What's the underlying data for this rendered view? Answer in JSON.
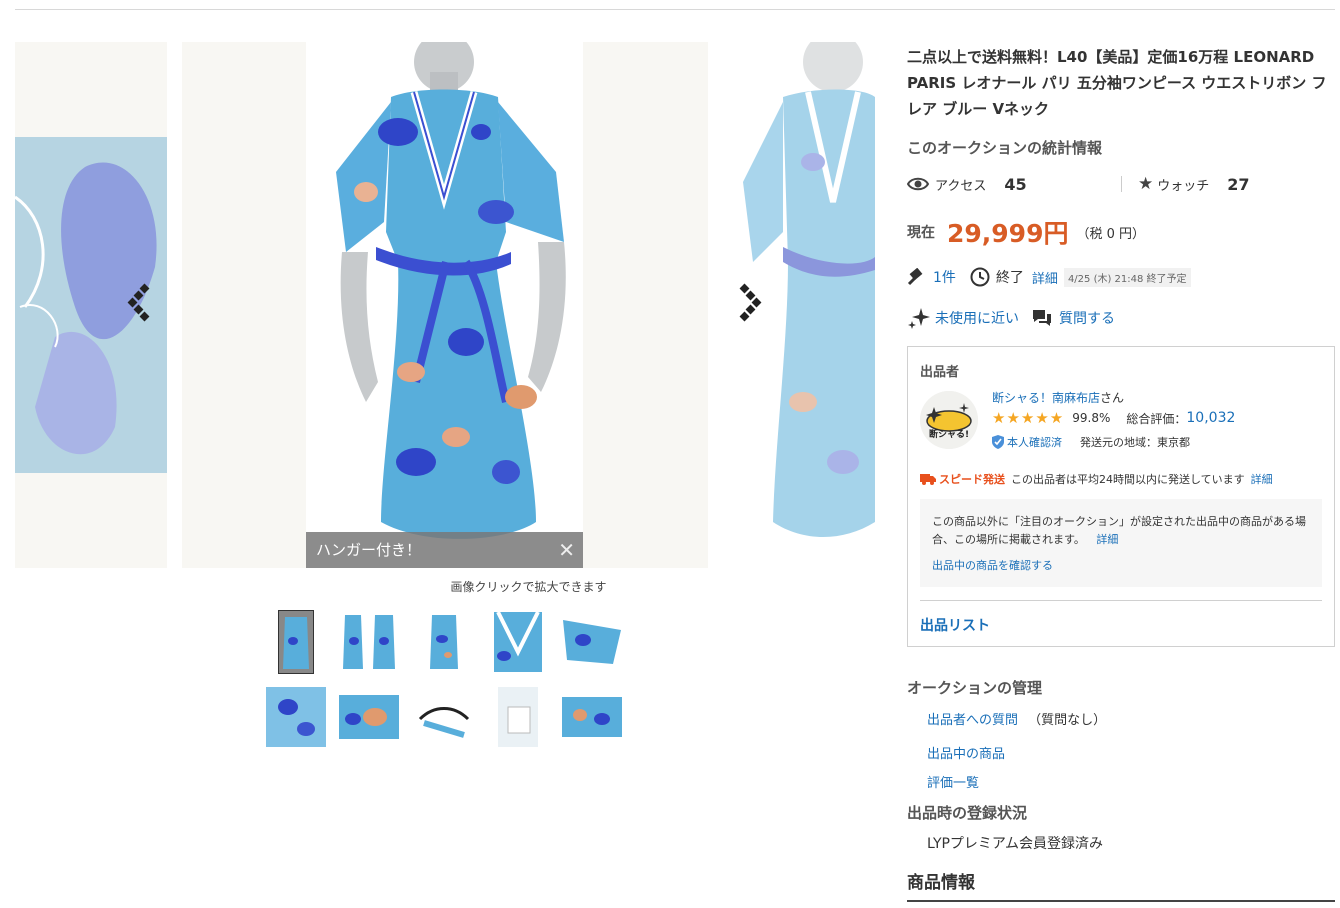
{
  "gallery": {
    "caption": "ハンガー付き！",
    "close_glyph": "✕",
    "zoom_note": "画像クリックで拡大できます",
    "dress_color": "#58aedb",
    "accent_color": "#3b4fd1"
  },
  "title": "二点以上で送料無料！L40【美品】定価16万程 LEONARD PARIS レオナール パリ 五分袖ワンピース ウエストリボン フレア ブルー Vネック",
  "stats": {
    "heading": "このオークションの統計情報",
    "access_label": "アクセス",
    "access_value": "45",
    "watch_label": "ウォッチ",
    "watch_value": "27"
  },
  "price": {
    "label": "現在",
    "value": "29,999円",
    "tax": "（税 0 円）"
  },
  "bid": {
    "count": "1件",
    "end_label": "終了",
    "detail_link": "詳細",
    "end_time": "4/25 (木) 21:48 終了予定"
  },
  "condition": {
    "label": "未使用に近い",
    "question_link": "質問する"
  },
  "seller": {
    "heading": "出品者",
    "name": "断シャる！南麻布店",
    "suffix": "さん",
    "avatar_text": "断シャる!",
    "stars": "★★★★★",
    "rating_percent": "99.8%",
    "total_label": "総合評価：",
    "total_value": "10,032",
    "verified": "本人確認済",
    "region": "発送元の地域：東京都",
    "speed_tag": "スピード発送",
    "speed_text": "この出品者は平均24時間以内に発送しています",
    "speed_detail": "詳細",
    "note": "この商品以外に「注目のオークション」が設定された出品中の商品がある場合、この場所に掲載されます。",
    "note_detail": "詳細",
    "note_link": "出品中の商品を確認する",
    "list_link": "出品リスト"
  },
  "management": {
    "heading": "オークションの管理",
    "question_link": "出品者への質問",
    "question_status": "（質問なし）",
    "items_link": "出品中の商品",
    "reviews_link": "評価一覧"
  },
  "registration": {
    "heading": "出品時の登録状況",
    "value": "LYPプレミアム会員登録済み"
  },
  "product_info_heading": "商品情報"
}
